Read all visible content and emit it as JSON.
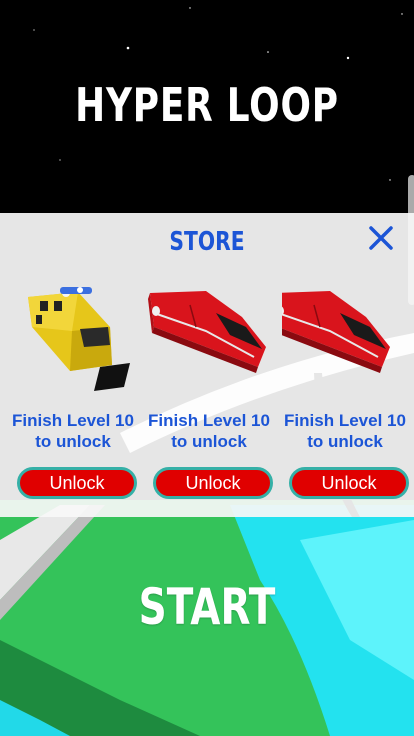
{
  "game_title": "HYPER LOOP",
  "store": {
    "title": "STORE",
    "close_icon": "close-icon",
    "items": [
      {
        "icon": "yellow-train-icon",
        "caption": "Finish Level 10 to unlock",
        "button": "Unlock"
      },
      {
        "icon": "red-train-icon",
        "caption": "Finish Level 10 to unlock",
        "button": "Unlock"
      },
      {
        "icon": "red-train-icon",
        "caption": "Finish Level 10 to unlock",
        "button": "Unlock"
      }
    ]
  },
  "start_label": "START",
  "colors": {
    "accent_blue": "#1c55d6",
    "button_red": "#e00000",
    "button_border": "#35b0a7",
    "ground_green": "#35c45a",
    "water_cyan": "#22e3f0"
  }
}
